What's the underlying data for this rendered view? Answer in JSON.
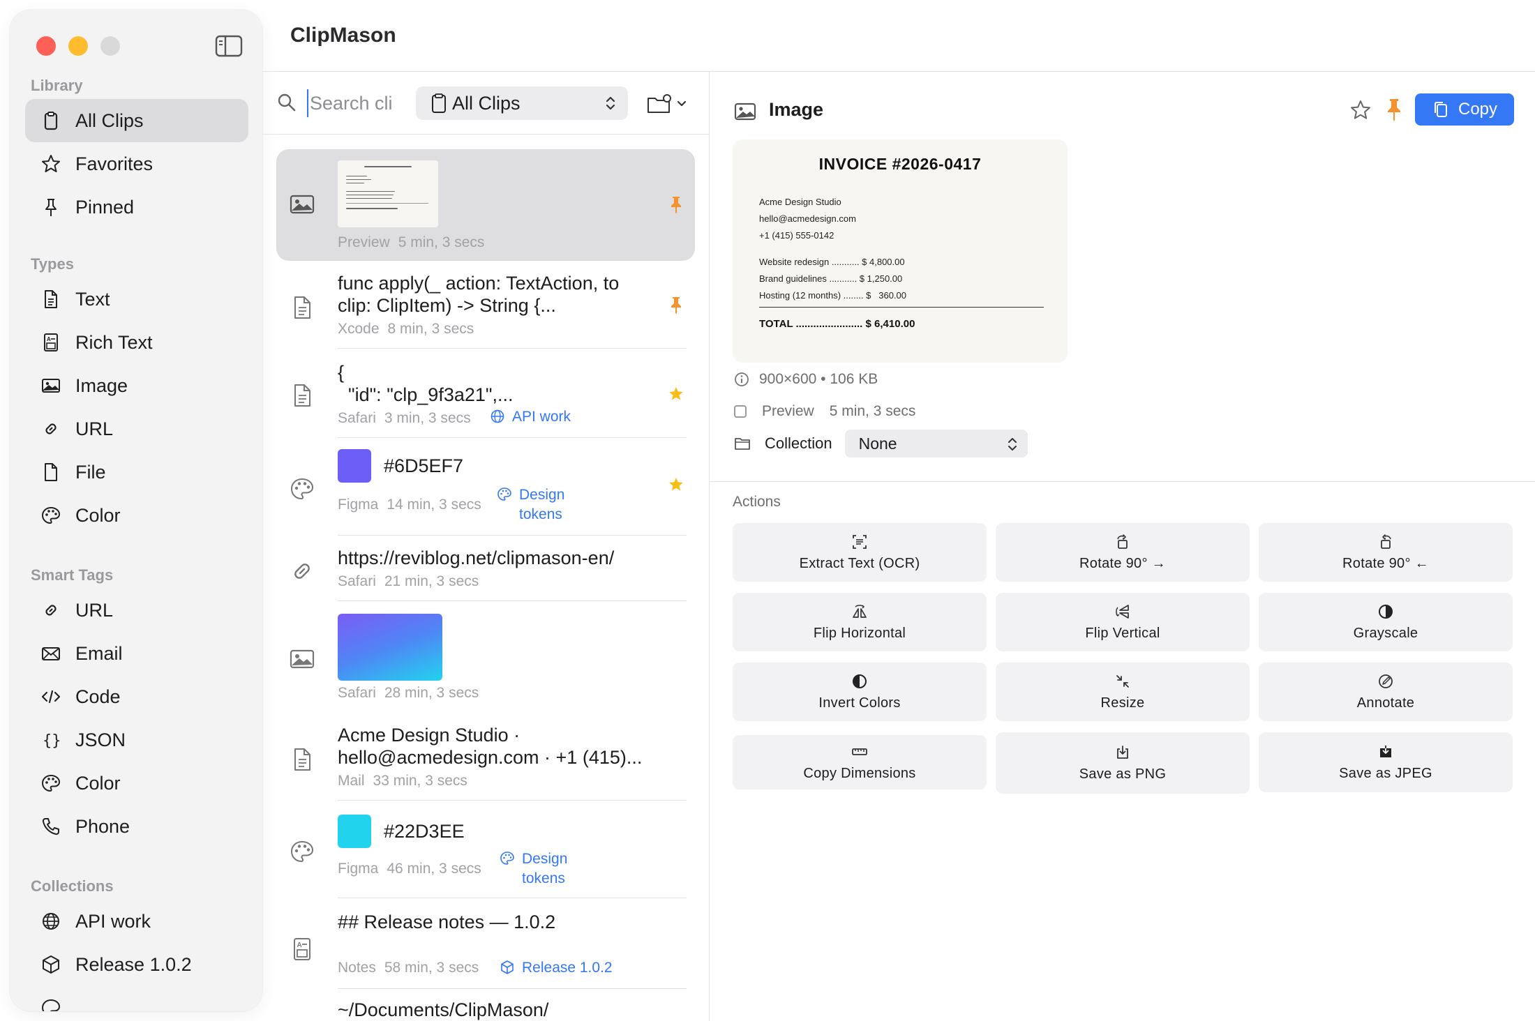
{
  "app": {
    "title": "ClipMason"
  },
  "sidebar": {
    "sections": {
      "library": "Library",
      "types": "Types",
      "smart_tags": "Smart Tags",
      "collections": "Collections"
    },
    "library": [
      {
        "label": "All Clips",
        "icon": "clipboard-icon",
        "active": true
      },
      {
        "label": "Favorites",
        "icon": "star-icon"
      },
      {
        "label": "Pinned",
        "icon": "pin-icon"
      }
    ],
    "types": [
      {
        "label": "Text",
        "icon": "document-icon"
      },
      {
        "label": "Rich Text",
        "icon": "rich-text-icon"
      },
      {
        "label": "Image",
        "icon": "image-icon"
      },
      {
        "label": "URL",
        "icon": "link-icon"
      },
      {
        "label": "File",
        "icon": "file-icon"
      },
      {
        "label": "Color",
        "icon": "palette-icon"
      }
    ],
    "smart_tags": [
      {
        "label": "URL",
        "icon": "link-icon"
      },
      {
        "label": "Email",
        "icon": "envelope-icon"
      },
      {
        "label": "Code",
        "icon": "code-icon"
      },
      {
        "label": "JSON",
        "icon": "braces-icon"
      },
      {
        "label": "Color",
        "icon": "palette-icon"
      },
      {
        "label": "Phone",
        "icon": "phone-icon"
      }
    ],
    "collections": [
      {
        "label": "API work",
        "icon": "globe-icon"
      },
      {
        "label": "Release 1.0.2",
        "icon": "box-icon"
      }
    ]
  },
  "search": {
    "placeholder": "Search clips"
  },
  "filter": {
    "selected": "All Clips"
  },
  "clips": {
    "c1": {
      "source": "Preview",
      "time": "5 min, 3 secs"
    },
    "c2": {
      "line1": "func apply(_ action: TextAction, to",
      "line2": "clip: ClipItem) -> String {...",
      "source": "Xcode",
      "time": "8 min, 3 secs"
    },
    "c3": {
      "line1": "{",
      "line2": "  \"id\": \"clp_9f3a21\",...",
      "source": "Safari",
      "time": "3 min, 3 secs",
      "tag": "API work"
    },
    "c4": {
      "hex": "#6D5EF7",
      "color": "#6D5EF7",
      "source": "Figma",
      "time": "14 min, 3 secs",
      "tag1": "Design",
      "tag2": "tokens"
    },
    "c5": {
      "line1": "https://reviblog.net/clipmason-en/",
      "source": "Safari",
      "time": "21 min, 3 secs"
    },
    "c6": {
      "source": "Safari",
      "time": "28 min, 3 secs"
    },
    "c7": {
      "line1": "Acme Design Studio ·",
      "line2": "hello@acmedesign.com · +1 (415)...",
      "source": "Mail",
      "time": "33 min, 3 secs"
    },
    "c8": {
      "hex": "#22D3EE",
      "color": "#22D3EE",
      "source": "Figma",
      "time": "46 min, 3 secs",
      "tag1": "Design",
      "tag2": "tokens"
    },
    "c9": {
      "line1": "## Release notes — 1.0.2",
      "source": "Notes",
      "time": "58 min, 3 secs",
      "tag": "Release 1.0.2"
    },
    "c10": {
      "line1": "~/Documents/ClipMason/"
    }
  },
  "detail": {
    "title": "Image",
    "copy_label": "Copy",
    "invoice": {
      "title": "INVOICE  #2026-0417",
      "company": "Acme Design Studio",
      "email": "hello@acmedesign.com",
      "phone": "+1 (415) 555-0142",
      "item1": "Website redesign ........... $ 4,800.00",
      "item2": "Brand guidelines ........... $ 1,250.00",
      "item3": "Hosting (12 months) ........ $   360.00",
      "total": "TOTAL ....................... $ 6,410.00"
    },
    "dimensions": "900×600 • 106 KB",
    "source": "Preview",
    "time": "5 min, 3 secs",
    "collection_label": "Collection",
    "collection_value": "None",
    "actions_title": "Actions",
    "actions": [
      "Extract Text (OCR)",
      "Rotate 90° →",
      "Rotate 90° ←",
      "Flip Horizontal",
      "Flip Vertical",
      "Grayscale",
      "Invert Colors",
      "Resize",
      "Annotate",
      "Copy Dimensions",
      "Save as PNG",
      "Save as JPEG"
    ]
  },
  "colors": {
    "accent": "#3478F6",
    "pin": "#F5922E",
    "star": "#F7BE18"
  }
}
